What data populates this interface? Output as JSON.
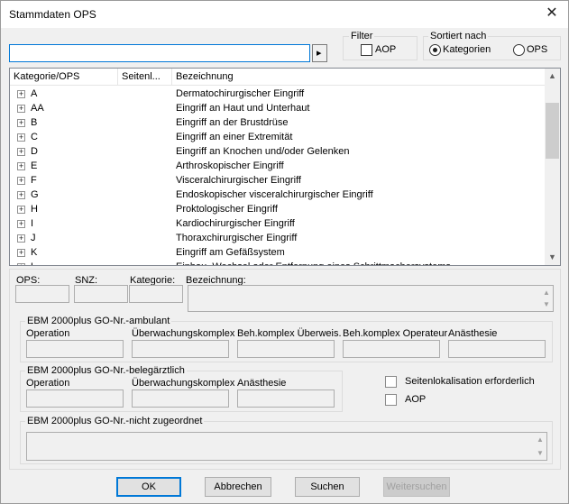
{
  "window": {
    "title": "Stammdaten OPS",
    "close_glyph": "✕"
  },
  "search": {
    "value": "",
    "go_glyph": "▸"
  },
  "filter": {
    "legend": "Filter",
    "aop_label": "AOP",
    "aop_checked": false
  },
  "sort": {
    "legend": "Sortiert nach",
    "option_categories": "Kategorien",
    "option_ops": "OPS",
    "selected": "Kategorien"
  },
  "tree": {
    "columns": [
      "Kategorie/OPS",
      "Seitenl...",
      "Bezeichnung"
    ],
    "rows": [
      {
        "code": "A",
        "desc": "Dermatochirurgischer Eingriff"
      },
      {
        "code": "AA",
        "desc": "Eingriff an Haut und Unterhaut"
      },
      {
        "code": "B",
        "desc": "Eingriff an der Brustdrüse"
      },
      {
        "code": "C",
        "desc": "Eingriff an einer Extremität"
      },
      {
        "code": "D",
        "desc": "Eingriff an Knochen und/oder Gelenken"
      },
      {
        "code": "E",
        "desc": "Arthroskopischer Eingriff"
      },
      {
        "code": "F",
        "desc": "Visceralchirurgischer Eingriff"
      },
      {
        "code": "G",
        "desc": "Endoskopischer visceralchirurgischer Eingriff"
      },
      {
        "code": "H",
        "desc": "Proktologischer Eingriff"
      },
      {
        "code": "I",
        "desc": "Kardiochirurgischer Eingriff"
      },
      {
        "code": "J",
        "desc": "Thoraxchirurgischer Eingriff"
      },
      {
        "code": "K",
        "desc": "Eingriff am Gefäßsystem"
      },
      {
        "code": "L",
        "desc": "Einbau, Wechsel oder Entfernung eines Schrittmachersystems"
      }
    ],
    "expander_glyph": "+"
  },
  "details": {
    "ops_label": "OPS:",
    "snz_label": "SNZ:",
    "kategorie_label": "Kategorie:",
    "bezeichnung_label": "Bezeichnung:"
  },
  "ambulant": {
    "legend": "EBM 2000plus GO-Nr.-ambulant",
    "labels": [
      "Operation",
      "Überwachungskomplex",
      "Beh.komplex Überweis.",
      "Beh.komplex Operateur",
      "Anästhesie"
    ]
  },
  "belegaerztlich": {
    "legend": "EBM 2000plus GO-Nr.-belegärztlich",
    "labels": [
      "Operation",
      "Überwachungskomplex",
      "Anästhesie"
    ]
  },
  "options": {
    "seitenlokalisation_label": "Seitenlokalisation erforderlich",
    "aop_label": "AOP"
  },
  "nicht_zugeordnet": {
    "legend": "EBM 2000plus GO-Nr.-nicht zugeordnet"
  },
  "buttons": {
    "ok": "OK",
    "cancel": "Abbrechen",
    "search": "Suchen",
    "search_next": "Weitersuchen"
  },
  "colors": {
    "accent": "#0078d7",
    "window_bg": "#f0f0f0",
    "disabled_text": "#a0a0a0"
  }
}
